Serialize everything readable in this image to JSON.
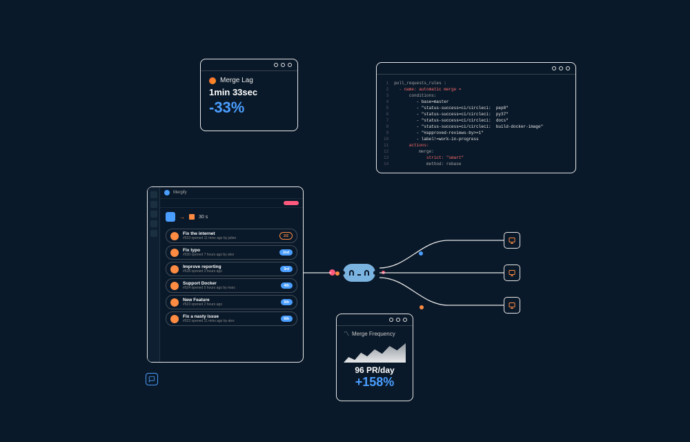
{
  "merge_lag": {
    "title": "Merge Lag",
    "time": "1min 33sec",
    "pct": "-33%"
  },
  "code": {
    "lines": [
      {
        "n": "1",
        "c": "k-key",
        "t": "pull_requests_rules :"
      },
      {
        "n": "2",
        "c": "k-name",
        "t": "  - name: automatic merge ="
      },
      {
        "n": "3",
        "c": "k-key",
        "t": "      conditions:"
      },
      {
        "n": "4",
        "c": "k-str",
        "t": "         - base=master"
      },
      {
        "n": "5",
        "c": "k-str",
        "t": "         - \"status-success=ci/circleci:  pep8\""
      },
      {
        "n": "6",
        "c": "k-str",
        "t": "         - \"status-success=ci/circleci:  py37\""
      },
      {
        "n": "7",
        "c": "k-str",
        "t": "         - \"status-success=ci/circleci:  docs\""
      },
      {
        "n": "8",
        "c": "k-str",
        "t": "         - \"status-success=ci/circleci:  build-docker-image\""
      },
      {
        "n": "9",
        "c": "k-str",
        "t": "         - \"#approved-reviews-by>=1\""
      },
      {
        "n": "10",
        "c": "k-str",
        "t": "         - label!=work-in-progress"
      },
      {
        "n": "11",
        "c": "k-name",
        "t": "      actions:"
      },
      {
        "n": "12",
        "c": "k-key",
        "t": "          merge:"
      },
      {
        "n": "13",
        "c": "k-name",
        "t": "             strict: \"smart\""
      },
      {
        "n": "14",
        "c": "k-key",
        "t": "             method: rebase"
      }
    ]
  },
  "queue": {
    "brand": "Mergify",
    "stat": "30 s",
    "items": [
      {
        "title": "Fix the internet",
        "sub": "#533 opened 11 mins ago by julien",
        "tag": "2/2",
        "style": "t-outline"
      },
      {
        "title": "Fix typo",
        "sub": "#530 opened 7 hours ago by alex",
        "tag": "2nd",
        "style": "t-blue"
      },
      {
        "title": "Improve reporting",
        "sub": "#528 opened 3 hours ago",
        "tag": "3rd",
        "style": "t-blue"
      },
      {
        "title": "Support Docker",
        "sub": "#524 opened 5 hours ago by marc",
        "tag": "4th",
        "style": "t-blue"
      },
      {
        "title": "New Feature",
        "sub": "#523 opened 2 hours ago",
        "tag": "5th",
        "style": "t-blue"
      },
      {
        "title": "Fix a nasty issue",
        "sub": "#522 opened 11 mins ago by alex",
        "tag": "6th",
        "style": "t-blue"
      }
    ]
  },
  "merge_freq": {
    "title": "Merge Frequency",
    "value": "96 PR/day",
    "pct": "+158%"
  },
  "chart_data": {
    "type": "area",
    "title": "Merge Frequency",
    "x": [
      1,
      2,
      3,
      4,
      5,
      6,
      7,
      8,
      9,
      10
    ],
    "values": [
      25,
      12,
      45,
      28,
      60,
      40,
      75,
      55,
      88,
      100
    ],
    "ylim": [
      0,
      100
    ]
  }
}
